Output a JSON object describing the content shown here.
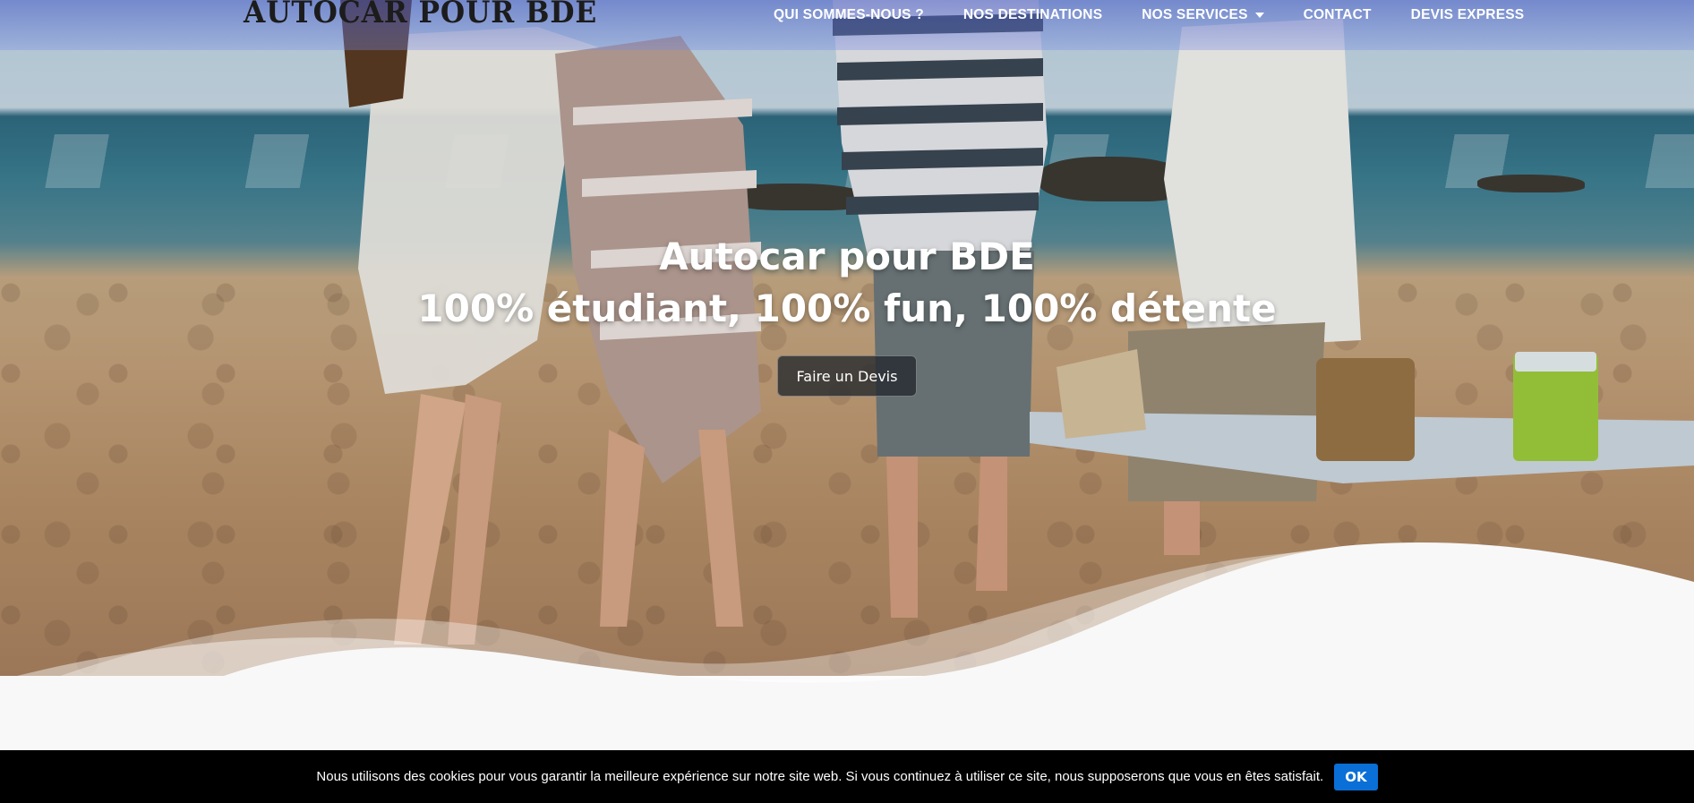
{
  "site": {
    "logo_text": "AUTOCAR POUR BDE"
  },
  "nav": {
    "items": [
      {
        "label": "QUI SOMMES-NOUS ?"
      },
      {
        "label": "NOS DESTINATIONS"
      },
      {
        "label": "NOS SERVICES",
        "has_dropdown": true
      },
      {
        "label": "CONTACT"
      },
      {
        "label": "DEVIS EXPRESS"
      }
    ]
  },
  "hero": {
    "title_line1": "Autocar pour BDE",
    "title_line2": "100% étudiant, 100% fun, 100% détente",
    "cta_label": "Faire un Devis",
    "background_image": "friends-on-beach-photo"
  },
  "cookie_banner": {
    "message": "Nous utilisons des cookies pour vous garantir la meilleure expérience sur notre site web. Si vous continuez à utiliser ce site, nous supposerons que vous en êtes satisfait.",
    "ok_label": "OK",
    "ok_color": "#0a6fd6"
  },
  "colors": {
    "nav_overlay": "#6a7fe0",
    "page_background": "#f8f8f9",
    "cookie_bar": "#000000"
  }
}
